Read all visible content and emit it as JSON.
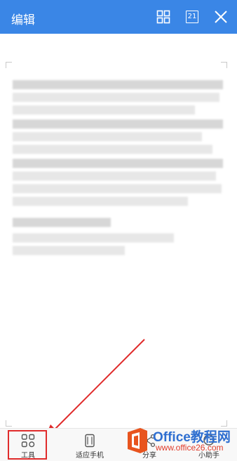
{
  "header": {
    "title": "编辑",
    "page_count": "21",
    "background": "#3a86e6"
  },
  "toolbar": {
    "items": [
      {
        "label": "工具",
        "icon": "tools-grid-icon"
      },
      {
        "label": "适应手机",
        "icon": "phone-fit-icon"
      },
      {
        "label": "分享",
        "icon": "share-icon"
      },
      {
        "label": "小助手",
        "icon": "assistant-icon"
      }
    ]
  },
  "watermark": {
    "brand": "Office教程网",
    "url": "www.office26.com"
  },
  "annotation": {
    "highlight_color": "#e02b2b"
  }
}
